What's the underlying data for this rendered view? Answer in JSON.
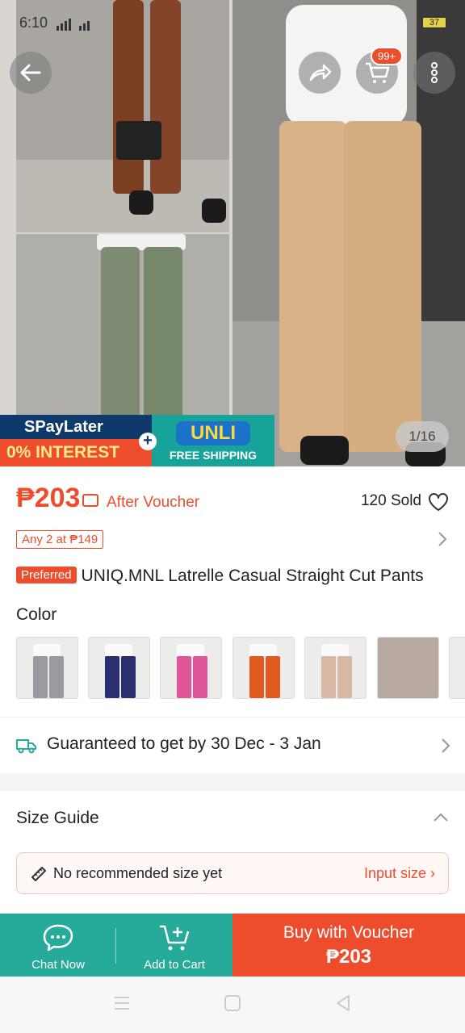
{
  "status_bar": {
    "time": "6:10",
    "signal": "Xz",
    "battery": "37"
  },
  "gallery": {
    "counter": "1/16",
    "cart_badge": "99+"
  },
  "promo": {
    "spaylater": "SPayLater",
    "interest": "0% INTEREST",
    "unli": "UNLI",
    "free_shipping": "FREE SHIPPING"
  },
  "price": {
    "amount": "₱203",
    "after_voucher": "After Voucher",
    "sold": "120 Sold"
  },
  "deal": {
    "label": "Any 2 at ₱149"
  },
  "product": {
    "badge": "Preferred",
    "title": "UNIQ.MNL Latrelle Casual Straight Cut Pants"
  },
  "color": {
    "label": "Color"
  },
  "swatches": [
    {
      "pants_color": "#9a9aa0"
    },
    {
      "pants_color": "#2a2f70"
    },
    {
      "pants_color": "#e0569a"
    },
    {
      "pants_color": "#e35a1e"
    },
    {
      "pants_color": "#d9b9a6"
    },
    {
      "pants_color": "#b8a8a2"
    }
  ],
  "delivery": {
    "text": "Guaranteed to get by 30 Dec - 3 Jan"
  },
  "size_guide": {
    "label": "Size Guide",
    "message": "No recommended size yet",
    "input": "Input size"
  },
  "bottom_bar": {
    "chat": "Chat Now",
    "cart": "Add to Cart",
    "buy_line1": "Buy with Voucher",
    "buy_line2": "₱203"
  },
  "colors": {
    "accent": "#ee4d2d",
    "teal": "#26aa99"
  }
}
